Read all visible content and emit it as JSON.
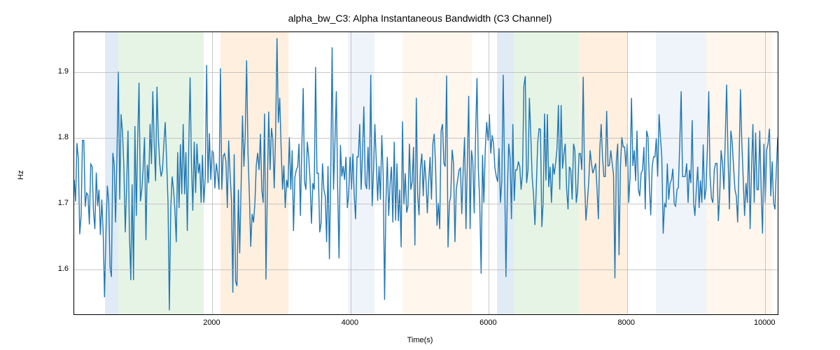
{
  "chart_data": {
    "type": "line",
    "title": "alpha_bw_C3: Alpha Instantaneous Bandwidth (C3 Channel)",
    "xlabel": "Time(s)",
    "ylabel": "Hz",
    "xlim": [
      0,
      10200
    ],
    "ylim": [
      1.53,
      1.96
    ],
    "yticks": [
      1.6,
      1.7,
      1.8,
      1.9
    ],
    "xticks": [
      2000,
      4000,
      6000,
      8000,
      10000
    ],
    "bands": [
      {
        "xstart": 450,
        "xend": 640,
        "color": "blue"
      },
      {
        "xstart": 640,
        "xend": 1870,
        "color": "green"
      },
      {
        "xstart": 2120,
        "xend": 3100,
        "color": "orange"
      },
      {
        "xstart": 3960,
        "xend": 4350,
        "color": "lightblue"
      },
      {
        "xstart": 4750,
        "xend": 5750,
        "color": "lightorange"
      },
      {
        "xstart": 6120,
        "xend": 6360,
        "color": "blue"
      },
      {
        "xstart": 6360,
        "xend": 7300,
        "color": "green"
      },
      {
        "xstart": 7300,
        "xend": 8000,
        "color": "orange"
      },
      {
        "xstart": 8420,
        "xend": 9150,
        "color": "lightblue"
      },
      {
        "xstart": 9150,
        "xend": 10100,
        "color": "lightorange"
      }
    ],
    "series": [
      {
        "name": "alpha_bw_C3",
        "x_start": 0,
        "x_step": 20,
        "values": [
          1.735,
          1.702,
          1.791,
          1.768,
          1.652,
          1.68,
          1.795,
          1.795,
          1.694,
          1.715,
          1.712,
          1.667,
          1.759,
          1.755,
          1.687,
          1.66,
          1.746,
          1.695,
          1.72,
          1.651,
          1.705,
          1.655,
          1.556,
          1.651,
          1.726,
          1.703,
          1.602,
          1.587,
          1.776,
          1.758,
          1.67,
          1.77,
          1.9,
          1.705,
          1.835,
          1.808,
          1.755,
          1.655,
          1.724,
          1.81,
          1.656,
          1.582,
          1.728,
          1.582,
          1.817,
          1.68,
          1.792,
          1.883,
          1.702,
          1.72,
          1.753,
          1.8,
          1.643,
          1.758,
          1.73,
          1.82,
          1.759,
          1.87,
          1.79,
          1.733,
          1.877,
          1.801,
          1.76,
          1.74,
          1.75,
          1.789,
          1.823,
          1.765,
          1.7,
          1.536,
          1.69,
          1.74,
          1.72,
          1.69,
          1.64,
          1.777,
          1.692,
          1.789,
          1.713,
          1.82,
          1.713,
          1.777,
          1.657,
          1.78,
          1.891,
          1.762,
          1.688,
          1.793,
          1.715,
          1.79,
          1.745,
          1.76,
          1.7,
          1.773,
          1.7,
          1.74,
          1.91,
          1.73,
          1.806,
          1.735,
          1.78,
          1.775,
          1.722,
          1.76,
          1.745,
          1.72,
          1.905,
          1.72,
          1.771,
          1.775,
          1.763,
          1.692,
          1.795,
          1.745,
          1.704,
          1.563,
          1.774,
          1.58,
          1.573,
          1.72,
          1.623,
          1.725,
          1.833,
          1.755,
          1.802,
          1.917,
          1.775,
          1.71,
          1.633,
          1.683,
          1.67,
          1.7,
          1.757,
          1.776,
          1.75,
          1.805,
          1.72,
          1.7,
          1.836,
          1.583,
          1.715,
          1.839,
          1.75,
          1.814,
          1.796,
          1.722,
          1.805,
          1.951,
          1.822,
          1.86,
          1.784,
          1.72,
          1.757,
          1.692,
          1.735,
          1.723,
          1.8,
          1.72,
          1.78,
          1.657,
          1.739,
          1.75,
          1.755,
          1.79,
          1.68,
          1.783,
          1.875,
          1.732,
          1.72,
          1.793,
          1.77,
          1.735,
          1.668,
          1.73,
          1.72,
          1.907,
          1.745,
          1.745,
          1.655,
          1.669,
          1.76,
          1.72,
          1.71,
          1.64,
          1.756,
          1.614,
          1.75,
          1.937,
          1.72,
          1.791,
          1.87,
          1.724,
          1.615,
          1.788,
          1.74,
          1.756,
          1.735,
          1.77,
          1.692,
          1.713,
          1.77,
          1.72,
          1.775,
          1.712,
          1.675,
          1.77,
          1.77,
          1.82,
          1.72,
          1.776,
          1.847,
          1.73,
          1.721,
          1.785,
          1.72,
          1.895,
          1.695,
          1.75,
          1.82,
          1.763,
          1.703,
          1.756,
          1.705,
          1.803,
          1.742,
          1.552,
          1.7,
          1.77,
          1.68,
          1.73,
          1.755,
          1.67,
          1.793,
          1.673,
          1.76,
          1.672,
          1.72,
          1.632,
          1.824,
          1.698,
          1.745,
          1.685,
          1.695,
          1.79,
          1.72,
          1.732,
          1.785,
          1.635,
          1.86,
          1.71,
          1.681,
          1.753,
          1.775,
          1.71,
          1.765,
          1.735,
          1.684,
          1.732,
          1.77,
          1.705,
          1.79,
          1.805,
          1.756,
          1.665,
          1.7,
          1.66,
          1.81,
          1.82,
          1.76,
          1.755,
          1.894,
          1.632,
          1.7,
          1.71,
          1.781,
          1.76,
          1.64,
          1.72,
          1.735,
          1.75,
          1.753,
          1.683,
          1.75,
          1.8,
          1.66,
          1.76,
          1.863,
          1.66,
          1.78,
          1.763,
          1.684,
          1.805,
          1.89,
          1.752,
          1.7,
          1.592,
          1.773,
          1.7,
          1.78,
          1.823,
          1.795,
          1.835,
          1.775,
          1.803,
          1.79,
          1.753,
          1.74,
          1.732,
          1.783,
          1.7,
          1.733,
          1.895,
          1.753,
          1.587,
          1.715,
          1.79,
          1.77,
          1.675,
          1.82,
          1.703,
          1.75,
          1.75,
          1.763,
          1.755,
          1.72,
          1.745,
          1.878,
          1.893,
          1.73,
          1.75,
          1.86,
          1.802,
          1.74,
          1.712,
          1.666,
          1.724,
          1.79,
          1.813,
          1.812,
          1.663,
          1.7,
          1.836,
          1.734,
          1.835,
          1.724,
          1.755,
          1.7,
          1.76,
          1.743,
          1.76,
          1.782,
          1.849,
          1.72,
          1.849,
          1.752,
          1.775,
          1.79,
          1.72,
          1.69,
          1.755,
          1.75,
          1.705,
          1.79,
          1.78,
          1.7,
          1.72,
          1.775,
          1.775,
          1.75,
          1.892,
          1.733,
          1.673,
          1.7,
          1.732,
          1.78,
          1.76,
          1.745,
          1.752,
          1.76,
          1.723,
          1.675,
          1.78,
          1.82,
          1.77,
          1.74,
          1.74,
          1.84,
          1.756,
          1.757,
          1.78,
          1.76,
          1.743,
          1.585,
          1.763,
          1.79,
          1.62,
          1.755,
          1.8,
          1.785,
          1.785,
          1.755,
          1.79,
          1.7,
          1.74,
          1.86,
          1.756,
          1.78,
          1.733,
          1.81,
          1.72,
          1.71,
          1.745,
          1.75,
          1.785,
          1.69,
          1.81,
          1.8,
          1.725,
          1.681,
          1.755,
          1.77,
          1.77,
          1.798,
          1.74,
          1.835,
          1.8,
          1.77,
          1.653,
          1.7,
          1.693,
          1.76,
          1.705,
          1.73,
          1.735,
          1.752,
          1.698,
          1.695,
          1.72,
          1.723,
          1.79,
          1.87,
          1.74,
          1.74,
          1.74,
          1.76,
          1.7,
          1.75,
          1.73,
          1.826,
          1.7,
          1.68,
          1.72,
          1.755,
          1.692,
          1.734,
          1.7,
          1.789,
          1.705,
          1.72,
          1.78,
          1.87,
          1.74,
          1.707,
          1.7,
          1.75,
          1.76,
          1.76,
          1.672,
          1.714,
          1.78,
          1.76,
          1.72,
          1.8,
          1.88,
          1.77,
          1.69,
          1.81,
          1.794,
          1.755,
          1.72,
          1.71,
          1.67,
          1.76,
          1.873,
          1.79,
          1.737,
          1.68,
          1.73,
          1.7,
          1.8,
          1.66,
          1.75,
          1.82,
          1.7,
          1.807,
          1.72,
          1.72,
          1.81,
          1.72,
          1.653,
          1.79,
          1.7,
          1.78,
          1.79,
          1.813,
          1.71,
          1.763,
          1.7,
          1.69,
          1.75,
          1.8,
          1.76,
          1.653
        ]
      }
    ]
  }
}
